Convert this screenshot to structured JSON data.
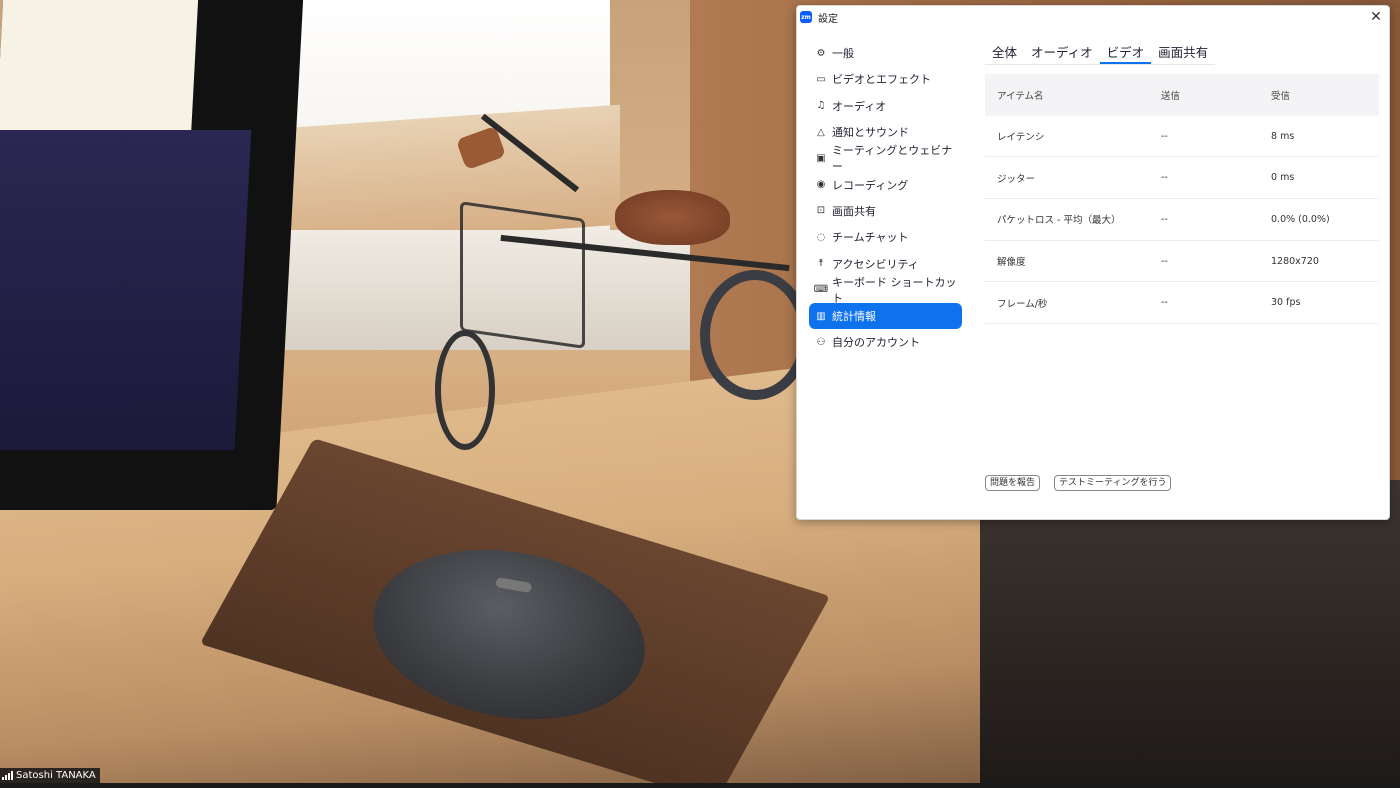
{
  "window": {
    "title": "設定",
    "app_logo": "zm"
  },
  "sidebar": {
    "items": [
      {
        "label": "一般",
        "icon": "gear-icon"
      },
      {
        "label": "ビデオとエフェクト",
        "icon": "video-camera-icon"
      },
      {
        "label": "オーディオ",
        "icon": "headphones-icon"
      },
      {
        "label": "通知とサウンド",
        "icon": "bell-icon"
      },
      {
        "label": "ミーティングとウェビナー",
        "icon": "meeting-screen-icon"
      },
      {
        "label": "レコーディング",
        "icon": "record-icon"
      },
      {
        "label": "画面共有",
        "icon": "share-screen-icon"
      },
      {
        "label": "チームチャット",
        "icon": "chat-icon"
      },
      {
        "label": "アクセシビリティ",
        "icon": "accessibility-icon"
      },
      {
        "label": "キーボード ショートカット",
        "icon": "keyboard-icon"
      },
      {
        "label": "統計情報",
        "icon": "statistics-icon",
        "active": true
      },
      {
        "label": "自分のアカウント",
        "icon": "user-icon"
      }
    ]
  },
  "tabs": [
    {
      "label": "全体"
    },
    {
      "label": "オーディオ"
    },
    {
      "label": "ビデオ",
      "active": true
    },
    {
      "label": "画面共有"
    }
  ],
  "table": {
    "headers": [
      "アイテム名",
      "送信",
      "受信"
    ],
    "rows": [
      [
        "レイテンシ",
        "--",
        "8 ms"
      ],
      [
        "ジッター",
        "--",
        "0 ms"
      ],
      [
        "パケットロス - 平均（最大）",
        "--",
        "0.0% (0.0%)"
      ],
      [
        "解像度",
        "--",
        "1280x720"
      ],
      [
        "フレーム/秒",
        "--",
        "30 fps"
      ]
    ]
  },
  "buttons": {
    "report": "問題を報告",
    "test_meeting": "テストミーティングを行う"
  },
  "participant": {
    "name": "Satoshi TANAKA",
    "icon": "signal-bars-icon"
  },
  "colors": {
    "accent": "#0e72ed",
    "logo": "#0b5cff"
  }
}
